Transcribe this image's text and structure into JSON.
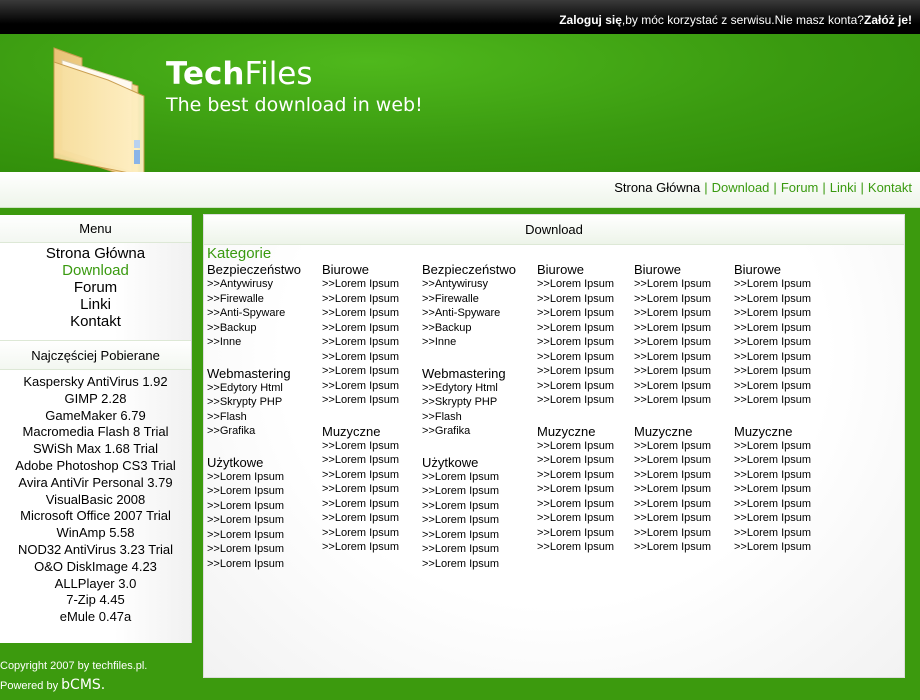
{
  "topbar": {
    "login_link": "Zaloguj się",
    "message": ",by móc korzystać z serwisu.Nie masz konta?",
    "register_link": "Załóż je!"
  },
  "header": {
    "title_bold": "Tech",
    "title_rest": "Files",
    "slogan": "The best download in web!"
  },
  "topnav": {
    "items": [
      "Strona Główna",
      "Download",
      "Forum",
      "Linki",
      "Kontakt"
    ],
    "separator": "|"
  },
  "sidebar": {
    "menu_heading": "Menu",
    "menu_items": [
      "Strona Główna",
      "Download",
      "Forum",
      "Linki",
      "Kontakt"
    ],
    "popular_heading": "Najczęściej Pobierane",
    "popular_items": [
      "Kaspersky AntiVirus 1.92",
      "GIMP 2.28",
      "GameMaker 6.79",
      "Macromedia Flash 8 Trial",
      "SWiSh Max 1.68 Trial",
      "Adobe Photoshop CS3 Trial",
      "Avira AntiVir Personal 3.79",
      "VisualBasic 2008",
      "Microsoft Office 2007 Trial",
      "WinAmp 5.58",
      "NOD32 AntiVirus 3.23 Trial",
      "O&O DiskImage 4.23",
      "ALLPlayer 3.0",
      "7-Zip 4.45",
      "eMule 0.47a"
    ]
  },
  "footer": {
    "copyright": "Copyright 2007 by techfiles.pl.",
    "powered_by": "Powered by",
    "cms": "bCMS."
  },
  "main": {
    "heading": "Download",
    "categories_title": "Kategorie",
    "columns": [
      [
        {
          "name": "Bezpieczeństwo",
          "links": [
            ">>Antywirusy",
            ">>Firewalle",
            ">>Anti-Spyware",
            ">>Backup",
            ">>Inne"
          ]
        },
        {
          "name": "Webmastering",
          "links": [
            ">>Edytory Html",
            ">>Skrypty PHP",
            ">>Flash",
            ">>Grafika"
          ]
        },
        {
          "name": "Użytkowe",
          "links": [
            ">>Lorem Ipsum",
            ">>Lorem Ipsum",
            ">>Lorem Ipsum",
            ">>Lorem Ipsum",
            ">>Lorem Ipsum",
            ">>Lorem Ipsum",
            ">>Lorem Ipsum"
          ]
        }
      ],
      [
        {
          "name": "Biurowe",
          "links": [
            ">>Lorem Ipsum",
            ">>Lorem Ipsum",
            ">>Lorem Ipsum",
            ">>Lorem Ipsum",
            ">>Lorem Ipsum",
            ">>Lorem Ipsum",
            ">>Lorem Ipsum",
            ">>Lorem Ipsum",
            ">>Lorem Ipsum"
          ]
        },
        {
          "name": "Muzyczne",
          "links": [
            ">>Lorem Ipsum",
            ">>Lorem Ipsum",
            ">>Lorem Ipsum",
            ">>Lorem Ipsum",
            ">>Lorem Ipsum",
            ">>Lorem Ipsum",
            ">>Lorem Ipsum",
            ">>Lorem Ipsum"
          ]
        }
      ],
      [
        {
          "name": "Bezpieczeństwo",
          "links": [
            ">>Antywirusy",
            ">>Firewalle",
            ">>Anti-Spyware",
            ">>Backup",
            ">>Inne"
          ]
        },
        {
          "name": "Webmastering",
          "links": [
            ">>Edytory Html",
            ">>Skrypty PHP",
            ">>Flash",
            ">>Grafika"
          ]
        },
        {
          "name": "Użytkowe",
          "links": [
            ">>Lorem Ipsum",
            ">>Lorem Ipsum",
            ">>Lorem Ipsum",
            ">>Lorem Ipsum",
            ">>Lorem Ipsum",
            ">>Lorem Ipsum",
            ">>Lorem Ipsum"
          ]
        }
      ],
      [
        {
          "name": "Biurowe",
          "links": [
            ">>Lorem Ipsum",
            ">>Lorem Ipsum",
            ">>Lorem Ipsum",
            ">>Lorem Ipsum",
            ">>Lorem Ipsum",
            ">>Lorem Ipsum",
            ">>Lorem Ipsum",
            ">>Lorem Ipsum",
            ">>Lorem Ipsum"
          ]
        },
        {
          "name": "Muzyczne",
          "links": [
            ">>Lorem Ipsum",
            ">>Lorem Ipsum",
            ">>Lorem Ipsum",
            ">>Lorem Ipsum",
            ">>Lorem Ipsum",
            ">>Lorem Ipsum",
            ">>Lorem Ipsum",
            ">>Lorem Ipsum"
          ]
        }
      ],
      [
        {
          "name": "Biurowe",
          "links": [
            ">>Lorem Ipsum",
            ">>Lorem Ipsum",
            ">>Lorem Ipsum",
            ">>Lorem Ipsum",
            ">>Lorem Ipsum",
            ">>Lorem Ipsum",
            ">>Lorem Ipsum",
            ">>Lorem Ipsum",
            ">>Lorem Ipsum"
          ]
        },
        {
          "name": "Muzyczne",
          "links": [
            ">>Lorem Ipsum",
            ">>Lorem Ipsum",
            ">>Lorem Ipsum",
            ">>Lorem Ipsum",
            ">>Lorem Ipsum",
            ">>Lorem Ipsum",
            ">>Lorem Ipsum",
            ">>Lorem Ipsum"
          ]
        }
      ],
      [
        {
          "name": "Biurowe",
          "links": [
            ">>Lorem Ipsum",
            ">>Lorem Ipsum",
            ">>Lorem Ipsum",
            ">>Lorem Ipsum",
            ">>Lorem Ipsum",
            ">>Lorem Ipsum",
            ">>Lorem Ipsum",
            ">>Lorem Ipsum",
            ">>Lorem Ipsum"
          ]
        },
        {
          "name": "Muzyczne",
          "links": [
            ">>Lorem Ipsum",
            ">>Lorem Ipsum",
            ">>Lorem Ipsum",
            ">>Lorem Ipsum",
            ">>Lorem Ipsum",
            ">>Lorem Ipsum",
            ">>Lorem Ipsum",
            ">>Lorem Ipsum"
          ]
        }
      ]
    ]
  },
  "colors": {
    "brand_green": "#3a9a10",
    "header_green": "#4fb81c",
    "topbar_black": "#000000"
  },
  "icons": {
    "logo": "folder-icon"
  }
}
